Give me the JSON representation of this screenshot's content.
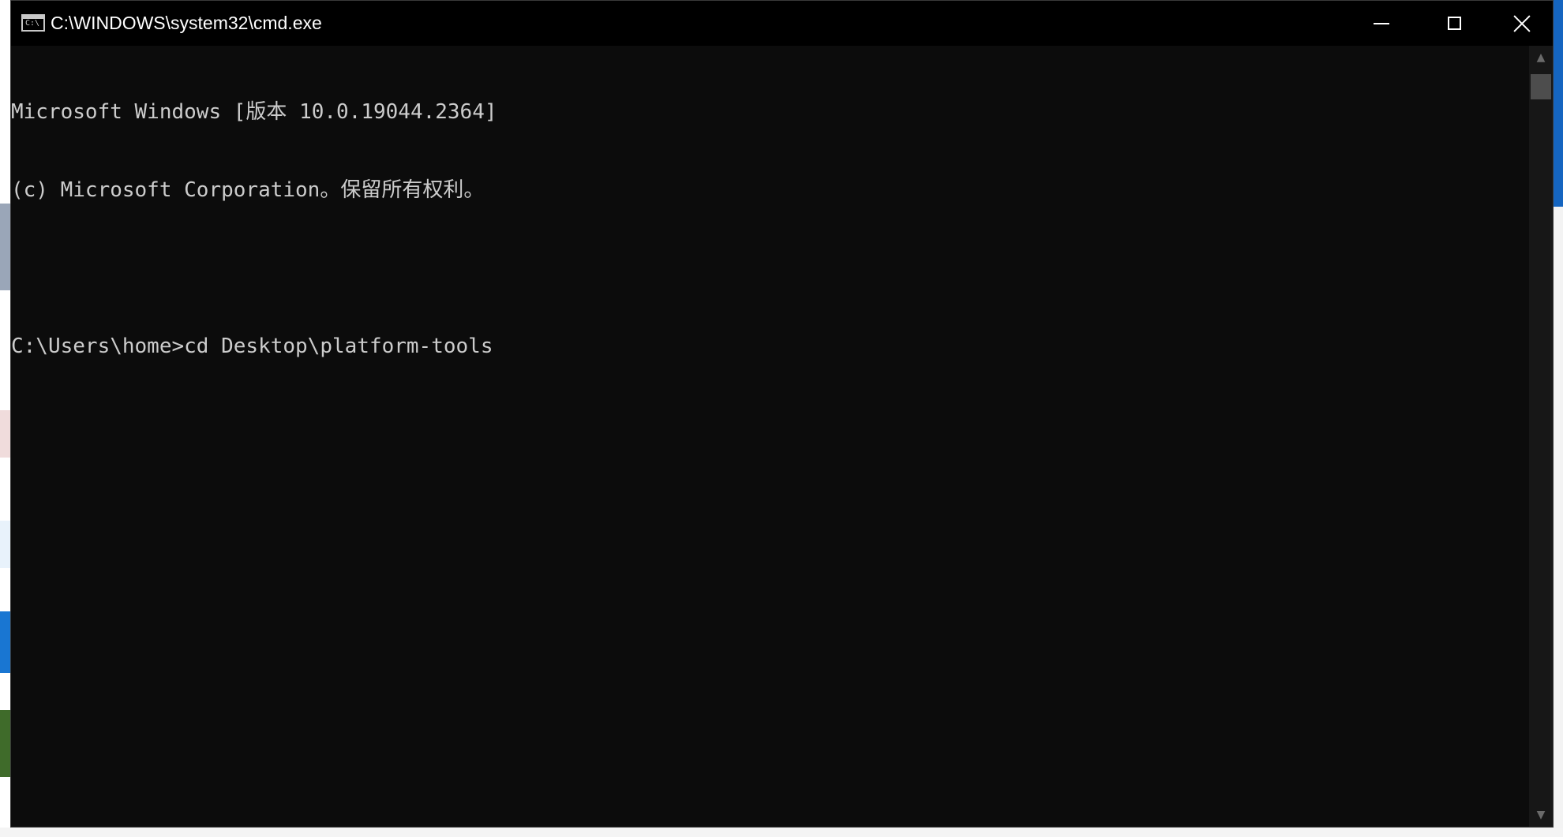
{
  "window": {
    "title": "C:\\WINDOWS\\system32\\cmd.exe",
    "app_icon_text": "C:\\",
    "buttons": {
      "minimize": "minimize-icon",
      "maximize": "maximize-icon",
      "close": "close-icon"
    }
  },
  "console": {
    "lines": [
      "Microsoft Windows [版本 10.0.19044.2364]",
      "(c) Microsoft Corporation。保留所有权利。",
      "",
      "C:\\Users\\home>cd Desktop\\platform-tools"
    ]
  },
  "colors": {
    "console_bg": "#0c0c0c",
    "console_fg": "#cccccc",
    "titlebar_bg": "#000000"
  }
}
